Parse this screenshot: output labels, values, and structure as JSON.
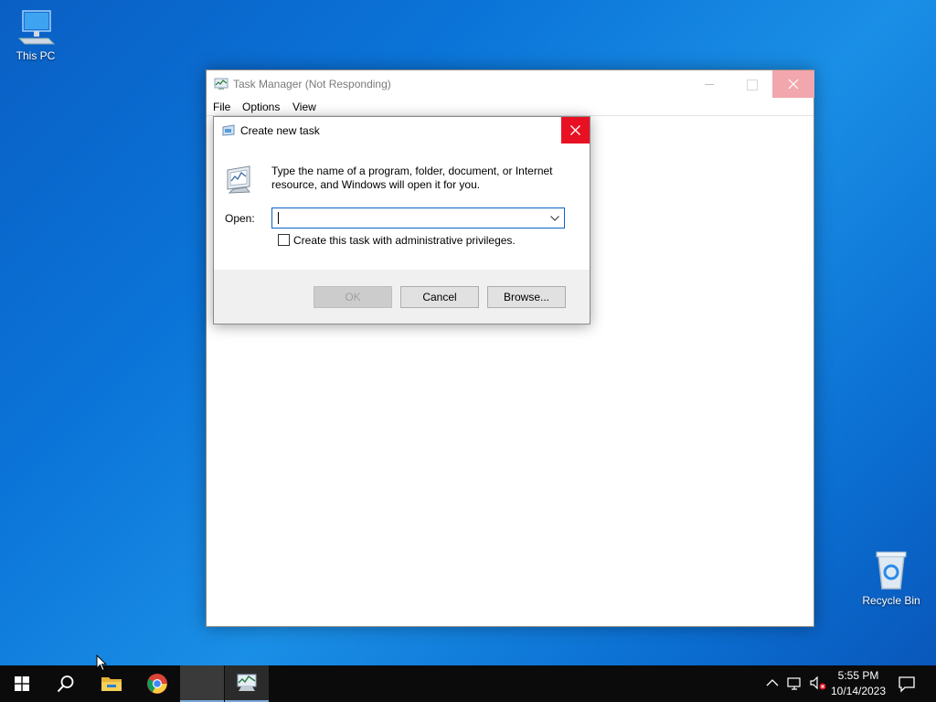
{
  "desktop": {
    "icons": [
      {
        "label": "This PC"
      },
      {
        "label": "Recycle Bin"
      }
    ]
  },
  "task_manager": {
    "title": "Task Manager (Not Responding)",
    "menu": [
      "File",
      "Options",
      "View"
    ]
  },
  "dialog": {
    "title": "Create new task",
    "description": "Type the name of a program, folder, document, or Internet resource, and Windows will open it for you.",
    "open_label": "Open:",
    "open_value": "",
    "admin_checkbox_label": "Create this task with administrative privileges.",
    "admin_checked": false,
    "buttons": {
      "ok": "OK",
      "cancel": "Cancel",
      "browse": "Browse..."
    }
  },
  "taskbar": {
    "time": "5:55 PM",
    "date": "10/14/2023",
    "items": [
      "start-icon",
      "search-icon",
      "file-explorer-icon",
      "chrome-icon",
      "blank-app",
      "task-manager-icon"
    ]
  },
  "colors": {
    "accent": "#0a64c4",
    "close_red": "#e81123",
    "taskbar": "#0b0b0b"
  }
}
